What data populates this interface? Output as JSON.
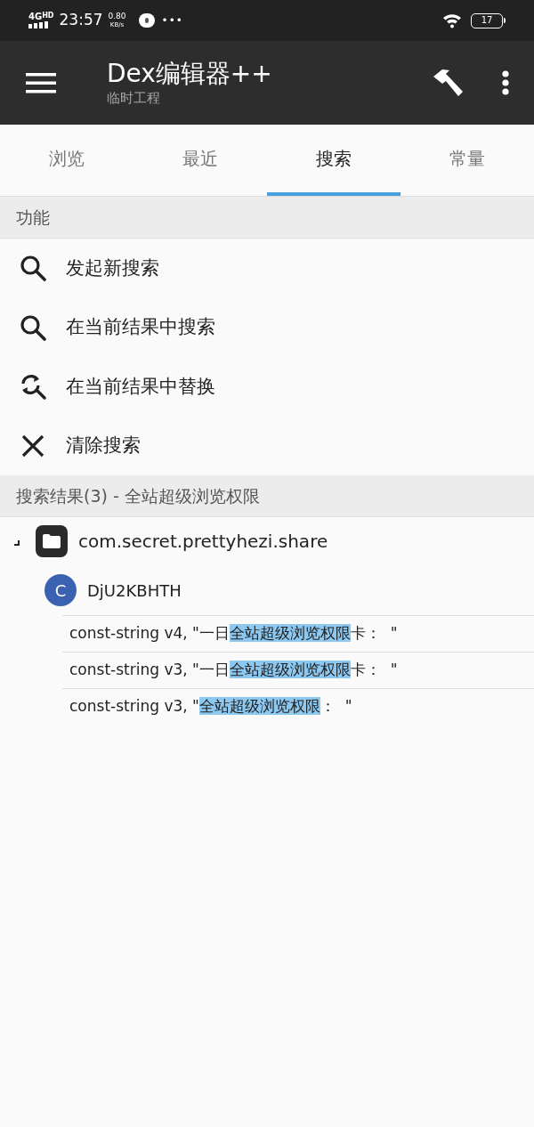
{
  "status_bar": {
    "network": "4G",
    "network_sub": "HD",
    "time": "23:57",
    "speed": "0.80",
    "speed_unit": "KB/s",
    "more": "•••",
    "battery": "17"
  },
  "app_bar": {
    "title": "Dex编辑器++",
    "subtitle": "临时工程"
  },
  "tabs": [
    {
      "label": "浏览",
      "selected": false
    },
    {
      "label": "最近",
      "selected": false
    },
    {
      "label": "搜索",
      "selected": true
    },
    {
      "label": "常量",
      "selected": false
    }
  ],
  "functions": {
    "header": "功能",
    "items": [
      {
        "kind": "search",
        "label": "发起新搜索"
      },
      {
        "kind": "search",
        "label": "在当前结果中搜索"
      },
      {
        "kind": "replace",
        "label": "在当前结果中替换"
      },
      {
        "kind": "clear",
        "label": "清除搜索"
      }
    ]
  },
  "results": {
    "header": "搜索结果(3) - 全站超级浏览权限",
    "tree": {
      "label": "com.secret.prettyhezi.share",
      "expanded": true,
      "children": [
        {
          "badge": "C",
          "label": "DjU2KBHTH",
          "children": [
            {
              "prefix": "const-string v4, \"一日",
              "match": "全站超级浏览权限",
              "suffix": "卡：  \""
            },
            {
              "prefix": "const-string v3, \"一日",
              "match": "全站超级浏览权限",
              "suffix": "卡：  \""
            },
            {
              "prefix": "const-string v3, \"",
              "match": "全站超级浏览权限",
              "suffix": "：  \""
            }
          ]
        }
      ]
    }
  }
}
